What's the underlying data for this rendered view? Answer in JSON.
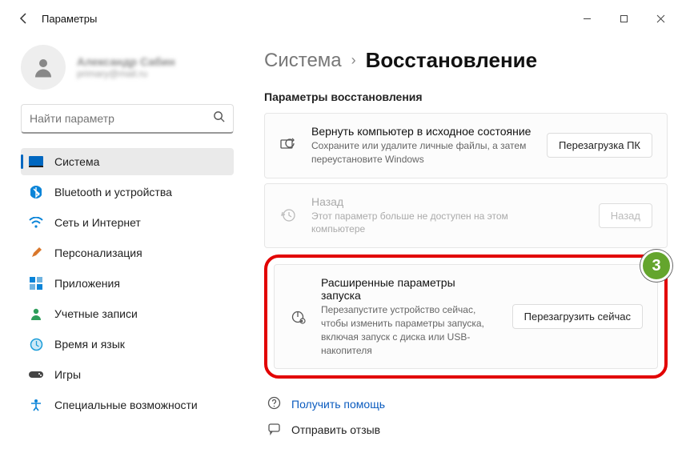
{
  "app_title": "Параметры",
  "profile": {
    "name": "Александр Сабин",
    "email": "primary@mail.ru"
  },
  "search": {
    "placeholder": "Найти параметр"
  },
  "sidebar": {
    "items": [
      {
        "label": "Система"
      },
      {
        "label": "Bluetooth и устройства"
      },
      {
        "label": "Сеть и Интернет"
      },
      {
        "label": "Персонализация"
      },
      {
        "label": "Приложения"
      },
      {
        "label": "Учетные записи"
      },
      {
        "label": "Время и язык"
      },
      {
        "label": "Игры"
      },
      {
        "label": "Специальные возможности"
      }
    ]
  },
  "breadcrumb": {
    "parent": "Система",
    "current": "Восстановление"
  },
  "section_heading": "Параметры восстановления",
  "cards": [
    {
      "title": "Вернуть компьютер в исходное состояние",
      "desc": "Сохраните или удалите личные файлы, а затем переустановите Windows",
      "button": "Перезагрузка ПК"
    },
    {
      "title": "Назад",
      "desc": "Этот параметр больше не доступен на этом компьютере",
      "button": "Назад"
    },
    {
      "title": "Расширенные параметры запуска",
      "desc": "Перезапустите устройство сейчас, чтобы изменить параметры запуска, включая запуск с диска или USB-накопителя",
      "button": "Перезагрузить сейчас"
    }
  ],
  "links": {
    "help": "Получить помощь",
    "feedback": "Отправить отзыв"
  },
  "annotation": {
    "badge": "3"
  }
}
